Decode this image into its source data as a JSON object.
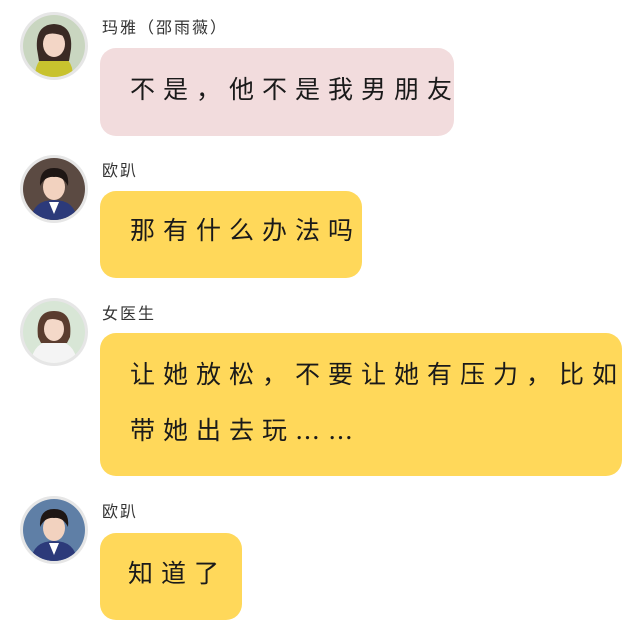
{
  "messages": [
    {
      "sender": "玛雅（邵雨薇）",
      "avatar_icon": "girl-avatar-icon",
      "bubble_color": "#f2dcdd",
      "lines": [
        "不是，他不是我男朋友"
      ]
    },
    {
      "sender": "欧趴",
      "avatar_icon": "boy-avatar-icon",
      "bubble_color": "#ffd85a",
      "lines": [
        "那有什么办法吗"
      ]
    },
    {
      "sender": "女医生",
      "avatar_icon": "woman-avatar-icon",
      "bubble_color": "#ffd85a",
      "lines": [
        "让她放松，不要让她有压力，比如",
        "带她出去玩……"
      ]
    },
    {
      "sender": "欧趴",
      "avatar_icon": "boy-avatar-icon",
      "bubble_color": "#ffd85a",
      "lines": [
        "知道了"
      ]
    }
  ]
}
